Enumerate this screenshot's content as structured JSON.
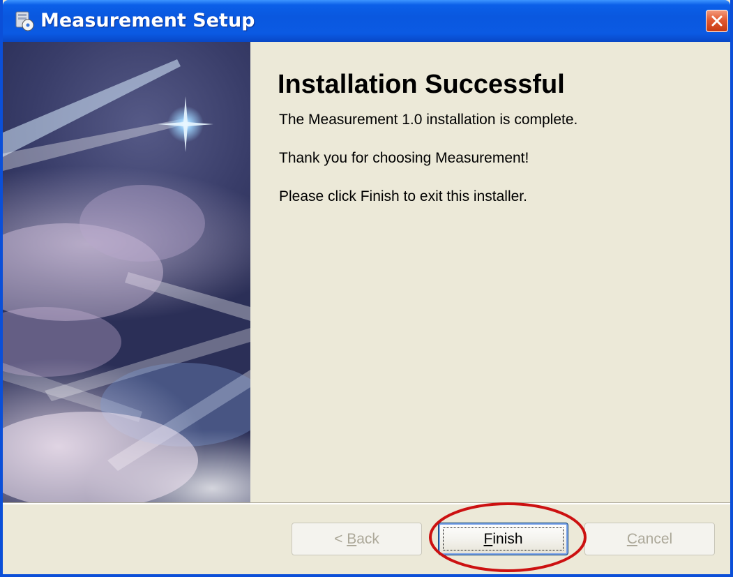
{
  "window": {
    "title": "Measurement Setup",
    "icon": "installer-icon",
    "close_icon": "close-icon"
  },
  "content": {
    "heading": "Installation Successful",
    "line1": "The Measurement 1.0 installation is complete.",
    "line2": "Thank you for choosing Measurement!",
    "line3": "Please click Finish to exit this installer."
  },
  "buttons": {
    "back": {
      "mnemonic": "B",
      "rest": "ack",
      "prefix": "< ",
      "enabled": false
    },
    "finish": {
      "mnemonic": "F",
      "rest": "inish",
      "enabled": true,
      "focused": true
    },
    "cancel": {
      "mnemonic": "C",
      "rest": "ancel",
      "enabled": false
    }
  },
  "colors": {
    "titlebar": "#0b5ae3",
    "dialog_bg": "#ece9d8",
    "close_button": "#e25a32",
    "highlight_ring": "#cc1111"
  }
}
